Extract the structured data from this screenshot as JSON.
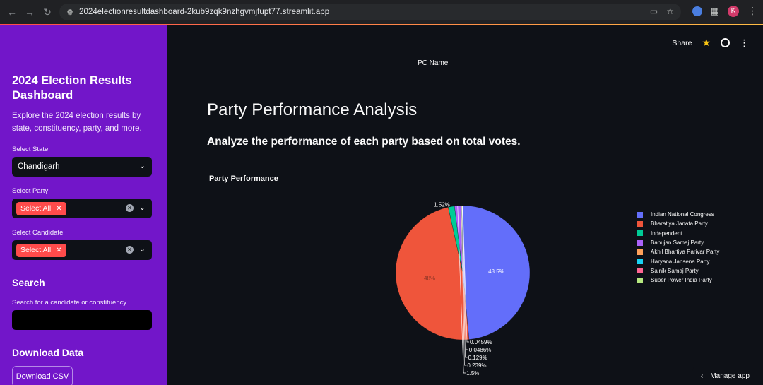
{
  "browser": {
    "url": "2024electionresultdashboard-2kub9zqk9nzhgvmjfupt77.streamlit.app",
    "avatar_letter": "K"
  },
  "sidebar": {
    "title": "2024 Election Results Dashboard",
    "description": "Explore the 2024 election results by state, constituency, party, and more.",
    "state": {
      "label": "Select State",
      "value": "Chandigarh"
    },
    "party": {
      "label": "Select Party",
      "tag": "Select All"
    },
    "candidate": {
      "label": "Select Candidate",
      "tag": "Select All"
    },
    "search_heading": "Search",
    "search_label": "Search for a candidate or constituency",
    "search_value": "",
    "download_heading": "Download Data",
    "download_button": "Download CSV"
  },
  "header": {
    "share": "Share"
  },
  "main": {
    "pc_name_label": "PC Name",
    "title": "Party Performance Analysis",
    "subtitle": "Analyze the performance of each party based on total votes."
  },
  "chart_data": {
    "type": "pie",
    "title": "Party Performance",
    "legend_position": "right",
    "labels": [
      "Indian National Congress",
      "Bharatiya Janata Party",
      "Independent",
      "Bahujan Samaj Party",
      "Akhil Bhartiya Parivar Party",
      "Haryana Jansena Party",
      "Sainik Samaj Party",
      "Super Power India Party"
    ],
    "values": [
      48.5,
      48,
      1.52,
      1.5,
      0.239,
      0.129,
      0.0486,
      0.0459
    ],
    "text_labels": [
      "48.5%",
      "48%",
      "1.52%",
      "1.5%",
      "0.239%",
      "0.129%",
      "0.0486%",
      "0.0459%"
    ],
    "colors": [
      "#636efa",
      "#ef553b",
      "#00cc96",
      "#ab63fa",
      "#ffa15a",
      "#19d3f3",
      "#ff6692",
      "#b6e880"
    ]
  },
  "manage_app": "Manage app"
}
